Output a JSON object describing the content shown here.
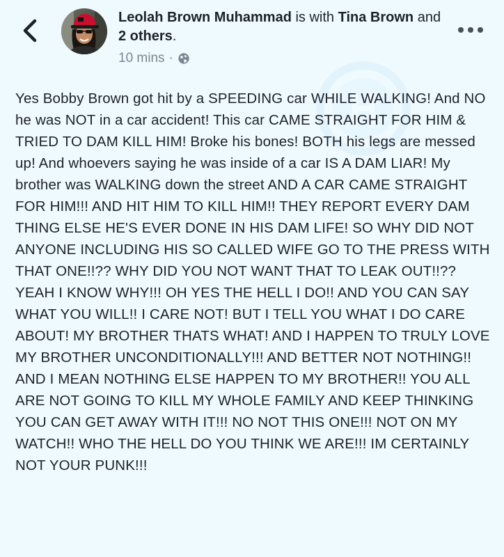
{
  "header": {
    "author": "Leolah Brown Muhammad",
    "is_with_text": "is with",
    "tagged_person": "Tina Brown",
    "and_text": "and",
    "others": "2 others",
    "period": ".",
    "time": "10 mins",
    "separator": "·",
    "privacy_icon": "globe-icon"
  },
  "icons": {
    "back": "chevron-left-icon",
    "more": "more-horizontal-icon"
  },
  "post": {
    "text": "Yes Bobby Brown got hit by a SPEEDING car WHILE WALKING! And NO he was NOT in a car accident! This car CAME STRAIGHT FOR HIM & TRIED TO DAM KILL HIM! Broke his bones! BOTH his legs are messed up! And whoevers saying he was inside of a car IS A DAM LIAR! My brother was WALKING down the street AND A CAR CAME STRAIGHT FOR HIM!!! AND HIT HIM TO KILL HIM!! THEY REPORT EVERY DAM THING ELSE HE'S EVER DONE IN HIS DAM LIFE! SO  WHY DID NOT ANYONE INCLUDING HIS SO CALLED WIFE GO TO THE PRESS WITH THAT ONE!!?? WHY DID YOU NOT WANT THAT TO LEAK OUT!!?? YEAH I KNOW WHY!!! OH YES THE HELL I DO!! AND YOU CAN SAY WHAT YOU WILL!! I CARE NOT!  BUT I TELL YOU WHAT I DO CARE ABOUT! MY BROTHER THATS WHAT! AND I HAPPEN TO TRULY LOVE MY BROTHER UNCONDITIONALLY!!! AND BETTER NOT NOTHING!! AND I MEAN NOTHING ELSE HAPPEN TO MY BROTHER!! YOU ALL ARE NOT GOING TO KILL MY WHOLE FAMILY AND KEEP THINKING YOU CAN GET AWAY WITH IT!!! NO NOT THIS ONE!!! NOT ON MY WATCH!! WHO THE HELL DO YOU THINK WE ARE!!! IM CERTAINLY NOT YOUR PUNK!!!"
  },
  "colors": {
    "background": "#effaff",
    "text": "#1d2129",
    "meta": "#7c8591",
    "hat": "#c8102e"
  }
}
